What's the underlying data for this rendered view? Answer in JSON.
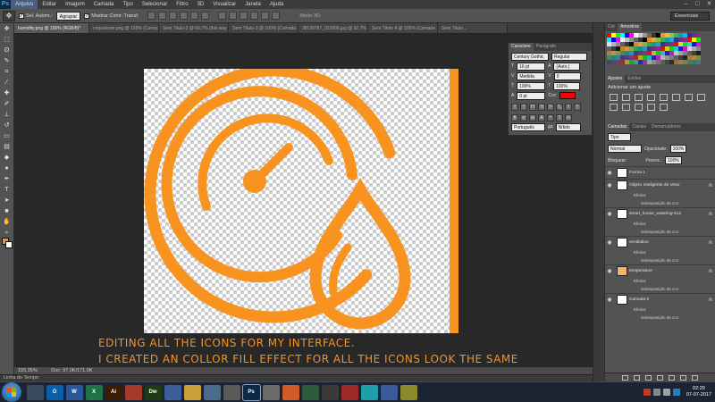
{
  "app": {
    "logo": "Ps"
  },
  "menu": [
    "Arquivo",
    "Editar",
    "Imagem",
    "Camada",
    "Tipo",
    "Selecionar",
    "Filtro",
    "3D",
    "Visualizar",
    "Janela",
    "Ajuda"
  ],
  "window_controls": {
    "minimize": "–",
    "maximize": "□",
    "close": "✕"
  },
  "options_bar": {
    "tool_icon": "move-tool-icon",
    "auto_select_label": "Sel. Autom.:",
    "auto_select_value": "Agrupar",
    "show_transform_label": "Mostrar Contr. Transf.",
    "mode_3d_label": "Modo 3D:",
    "workspace": "Essenciais"
  },
  "tabs": [
    {
      "label": "humidity.png @ 156% (RGB/8)*",
      "active": true
    },
    {
      "label": "coqoakone.png @ 155% (Camada 1, RGB/...",
      "active": false
    },
    {
      "label": "Sem Título-2 @ 66.7% (this way i could find m...",
      "active": false
    },
    {
      "label": "Sem Título-3 @ 100% (Camada 1, RGB/...",
      "active": false
    },
    {
      "label": "28139787_022006.jpg @ 92.7% (my should tp, R...",
      "active": false
    },
    {
      "label": "Sem Título 4 @ 100% (Camada 1, RGB/...",
      "active": false
    },
    {
      "label": "Sem Título...",
      "active": false
    }
  ],
  "caption": {
    "line1": "EDITING ALL THE ICONS FOR MY INTERFACE.",
    "line2": "I CREATED AN COLLOR FILL EFFECT FOR ALL THE ICONS LOOK THE SAME"
  },
  "status": {
    "zoom": "155,95%",
    "doc": "Doc: 97,0K/171,0K"
  },
  "timeline_label": "Linha do Tempo",
  "character_panel": {
    "tabs": [
      "Caractere",
      "Parágrafo"
    ],
    "font": "Century Gothic",
    "style": "Regular",
    "size": "16 pt",
    "leading": "(Auto.)",
    "kerning": "Medida",
    "tracking": "0",
    "scale_v": "100%",
    "scale_h": "100%",
    "baseline": "0 pt",
    "color_label": "Cor:",
    "language": "Português",
    "aa": "Nítido",
    "aa_label": "a̲a"
  },
  "swatches_panel": {
    "tabs": [
      "Cor",
      "Amostras"
    ]
  },
  "adjust_panel": {
    "tabs": [
      "Ajustes",
      "Estilos"
    ],
    "label": "Adicionar um ajuste"
  },
  "layers_panel": {
    "tabs": [
      "Camadas",
      "Canais",
      "Demarcadores"
    ],
    "filter": "Tipo",
    "blend": "Normal",
    "opacity_label": "Opacidade:",
    "opacity": "100%",
    "lock_label": "Bloquear:",
    "fill_label": "Preenc.:",
    "fill": "100%",
    "layers": [
      {
        "name": "Forma 1",
        "visible": true,
        "fx": false,
        "thumb": "white",
        "effects": []
      },
      {
        "name": "Objeto Inteligente de Vetor",
        "visible": true,
        "fx": true,
        "thumb": "white",
        "effects": [
          "Efeitos",
          "Sobreposição de Cor"
        ]
      },
      {
        "name": "smart_house_watering-512",
        "visible": true,
        "fx": true,
        "thumb": "white",
        "effects": [
          "Efeitos",
          "Sobreposição de Cor"
        ]
      },
      {
        "name": "ventilation",
        "visible": true,
        "fx": true,
        "thumb": "white",
        "effects": [
          "Efeitos",
          "Sobreposição de Cor"
        ]
      },
      {
        "name": "temperature",
        "visible": true,
        "fx": true,
        "thumb": "orange",
        "effects": [
          "Efeitos",
          "Sobreposição de Cor"
        ]
      },
      {
        "name": "Camada 0",
        "visible": true,
        "fx": true,
        "thumb": "white",
        "effects": [
          "Efeitos",
          "Sobreposição de Cor"
        ]
      }
    ]
  },
  "taskbar": {
    "items": [
      {
        "label": "",
        "color": "#3a4a60"
      },
      {
        "label": "O",
        "color": "#0a5fa8"
      },
      {
        "label": "W",
        "color": "#2b579a"
      },
      {
        "label": "X",
        "color": "#217346"
      },
      {
        "label": "Ai",
        "color": "#3b1d05"
      },
      {
        "label": "",
        "color": "#a33a2a"
      },
      {
        "label": "Dw",
        "color": "#1f3b16"
      },
      {
        "label": "",
        "color": "#3b5f9a"
      },
      {
        "label": "",
        "color": "#c8a13a"
      },
      {
        "label": "",
        "color": "#4c6a8a"
      },
      {
        "label": "",
        "color": "#5a5a5a"
      },
      {
        "label": "Ps",
        "color": "#0b2a45",
        "active": true
      },
      {
        "label": "",
        "color": "#6a6a6a"
      },
      {
        "label": "",
        "color": "#d15a2a"
      },
      {
        "label": "",
        "color": "#2d5a3a"
      },
      {
        "label": "",
        "color": "#3a3a3a"
      },
      {
        "label": "",
        "color": "#a02a2a"
      },
      {
        "label": "",
        "color": "#1f9faa"
      },
      {
        "label": "",
        "color": "#3a5a9a"
      },
      {
        "label": "",
        "color": "#8a8a2a"
      }
    ],
    "time": "02:29",
    "date": "07-07-2017"
  },
  "colors": {
    "accent": "#f7931e",
    "text_color_chip": "#ff0000"
  }
}
